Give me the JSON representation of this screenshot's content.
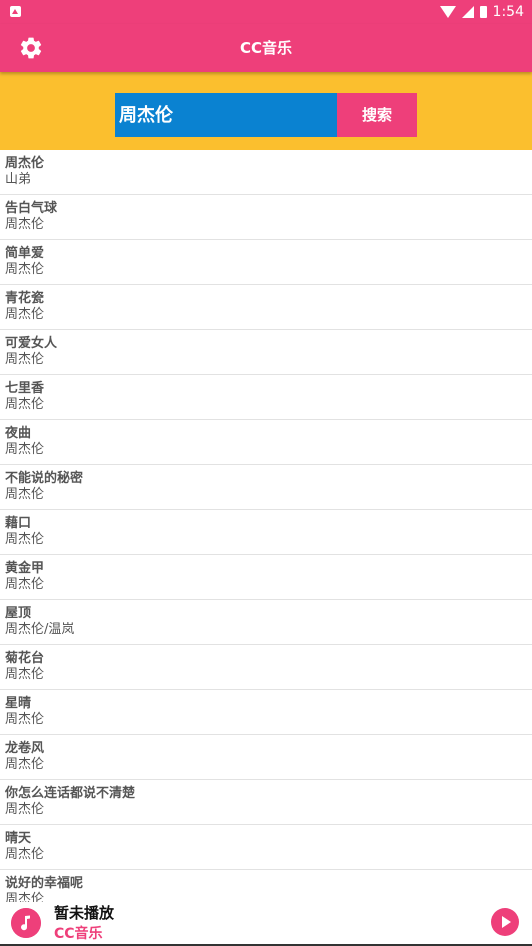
{
  "status_bar": {
    "time": "1:54"
  },
  "app_bar": {
    "title": "CC音乐",
    "settings_icon": "gear-icon"
  },
  "search": {
    "query": "周杰伦",
    "button_label": "搜索"
  },
  "songs": [
    {
      "name": "周杰伦",
      "artist": "山弟"
    },
    {
      "name": "告白气球",
      "artist": "周杰伦"
    },
    {
      "name": "简单爱",
      "artist": "周杰伦"
    },
    {
      "name": "青花瓷",
      "artist": "周杰伦"
    },
    {
      "name": "可爱女人",
      "artist": "周杰伦"
    },
    {
      "name": "七里香",
      "artist": "周杰伦"
    },
    {
      "name": "夜曲",
      "artist": "周杰伦"
    },
    {
      "name": "不能说的秘密",
      "artist": "周杰伦"
    },
    {
      "name": "藉口",
      "artist": "周杰伦"
    },
    {
      "name": "黄金甲",
      "artist": "周杰伦"
    },
    {
      "name": "屋顶",
      "artist": "周杰伦/温岚"
    },
    {
      "name": "菊花台",
      "artist": "周杰伦"
    },
    {
      "name": "星晴",
      "artist": "周杰伦"
    },
    {
      "name": "龙卷风",
      "artist": "周杰伦"
    },
    {
      "name": "你怎么连话都说不清楚",
      "artist": "周杰伦"
    },
    {
      "name": "晴天",
      "artist": "周杰伦"
    },
    {
      "name": "说好的幸福呢",
      "artist": "周杰伦"
    }
  ],
  "player": {
    "title": "暂未播放",
    "subtitle": "CC音乐"
  },
  "colors": {
    "primary": "#ee3f7a",
    "search_bg": "#fbbf2e",
    "input_bg": "#0a82d1"
  }
}
